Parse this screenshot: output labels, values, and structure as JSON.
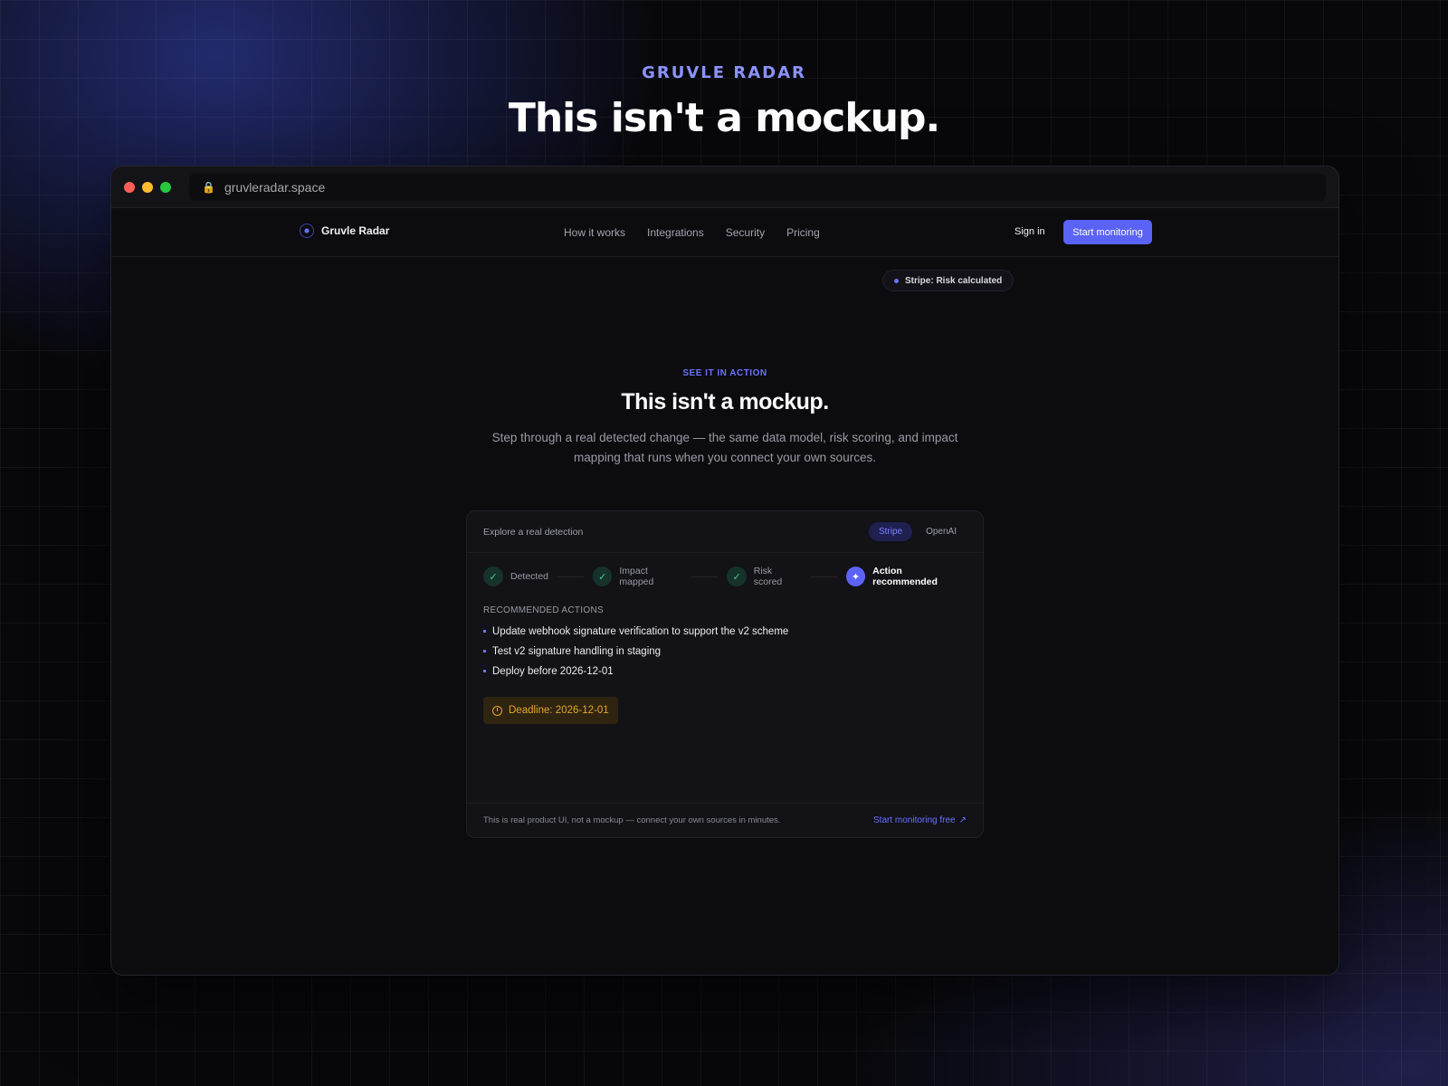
{
  "hero": {
    "eyebrow": "GRUVLE RADAR",
    "headline": "This isn't a mockup."
  },
  "browser": {
    "url": "gruvleradar.space",
    "lock_icon": "lock-icon"
  },
  "nav": {
    "brand": "Gruvle Radar",
    "links": [
      "How it works",
      "Integrations",
      "Security",
      "Pricing"
    ],
    "signin": "Sign in",
    "cta": "Start monitoring"
  },
  "toast": {
    "text": "Stripe: Risk calculated"
  },
  "section": {
    "kicker": "SEE IT IN ACTION",
    "title": "This isn't a mockup.",
    "description": "Step through a real detected change — the same data model, risk scoring, and impact mapping that runs when you connect your own sources."
  },
  "card": {
    "label": "Explore a real detection",
    "tabs": [
      "Stripe",
      "OpenAI"
    ],
    "active_tab": "Stripe",
    "steps": [
      {
        "label": "Detected",
        "done": true
      },
      {
        "label": "Impact mapped",
        "done": true
      },
      {
        "label": "Risk scored",
        "done": true
      },
      {
        "label": "Action recommended",
        "done": false,
        "active": true
      }
    ],
    "actions_title": "RECOMMENDED ACTIONS",
    "actions": [
      "Update webhook signature verification to support the v2 scheme",
      "Test v2 signature handling in staging",
      "Deploy before 2026-12-01"
    ],
    "deadline": "Deadline: 2026-12-01",
    "footer_text": "This is real product UI, not a mockup — connect your own sources in minutes.",
    "footer_link": "Start monitoring free"
  },
  "colors": {
    "accent": "#5b63f6",
    "deadline": "#e3a72a",
    "success": "#3fd08a"
  }
}
